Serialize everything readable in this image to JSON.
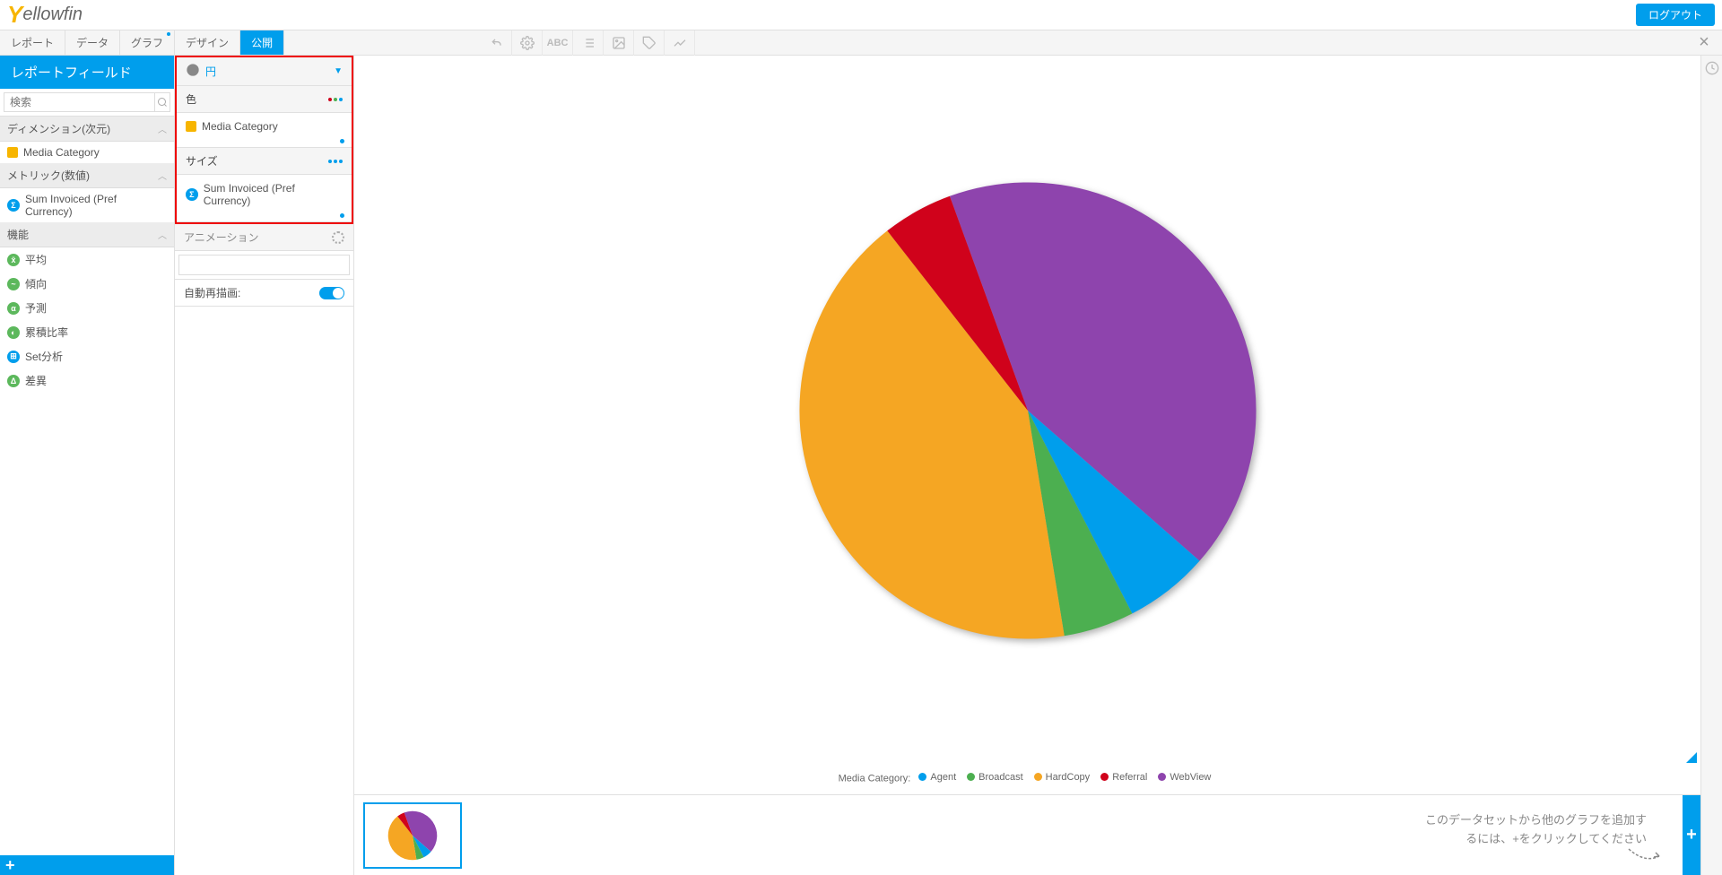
{
  "brand": {
    "y": "Y",
    "rest": "ellowfin"
  },
  "logout": "ログアウト",
  "tabs": {
    "report": "レポート",
    "data": "データ",
    "graph": "グラフ",
    "design": "デザイン",
    "publish": "公開"
  },
  "left": {
    "title": "レポートフィールド",
    "search_ph": "検索",
    "dim_hdr": "ディメンション(次元)",
    "dim_field": "Media Category",
    "metric_hdr": "メトリック(数値)",
    "metric_field": "Sum Invoiced (Pref Currency)",
    "func_hdr": "機能",
    "funcs": {
      "avg": "平均",
      "trend": "傾向",
      "forecast": "予測",
      "cumratio": "累積比率",
      "setanalysis": "Set分析",
      "variance": "差異"
    }
  },
  "config": {
    "chart_type": "円",
    "color_hdr": "色",
    "color_field": "Media Category",
    "size_hdr": "サイズ",
    "size_field": "Sum Invoiced (Pref Currency)",
    "animation": "アニメーション",
    "auto_redraw": "自動再描画:"
  },
  "legend_label": "Media Category:",
  "hint": {
    "l1": "このデータセットから他のグラフを追加す",
    "l2": "るには、+をクリックしてください"
  },
  "chart_data": {
    "type": "pie",
    "title": "",
    "legend_title": "Media Category",
    "series": [
      {
        "name": "WebView",
        "value": 42,
        "color": "#8e44ad"
      },
      {
        "name": "Agent",
        "value": 6,
        "color": "#009eec"
      },
      {
        "name": "Broadcast",
        "value": 5,
        "color": "#4caf50"
      },
      {
        "name": "HardCopy",
        "value": 42,
        "color": "#f5a623"
      },
      {
        "name": "Referral",
        "value": 5,
        "color": "#d0021b"
      }
    ],
    "legend_order": [
      "Agent",
      "Broadcast",
      "HardCopy",
      "Referral",
      "WebView"
    ]
  }
}
